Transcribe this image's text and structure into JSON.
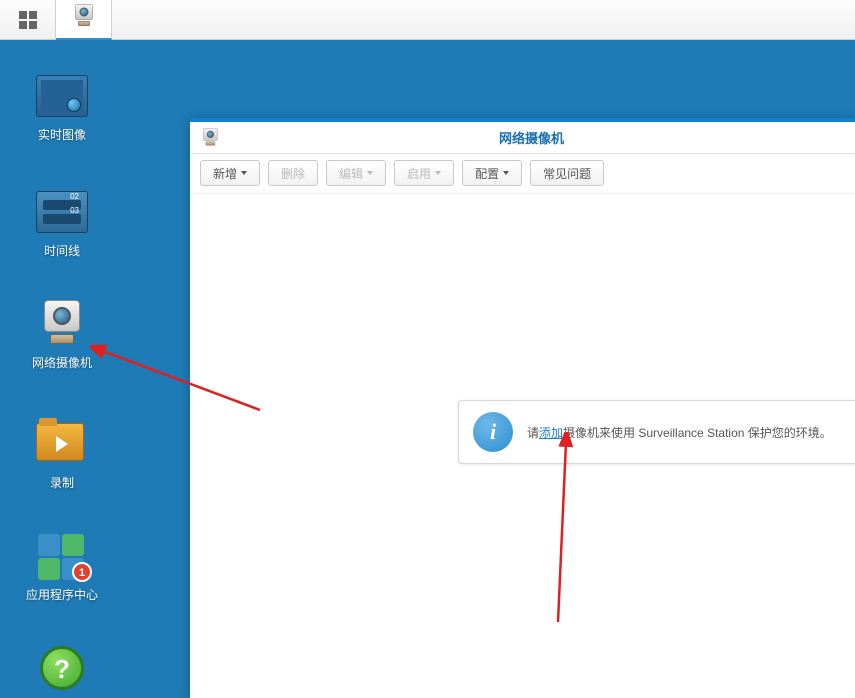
{
  "taskbar": {
    "menu_icon": "apps-grid-icon",
    "active_icon": "camera-icon"
  },
  "desktop": {
    "liveview": {
      "label": "实时图像"
    },
    "timeline": {
      "label": "时间线",
      "tag1": "02",
      "tag2": "03"
    },
    "camera": {
      "label": "网络摄像机"
    },
    "record": {
      "label": "录制"
    },
    "apps": {
      "label": "应用程序中心",
      "badge": "1"
    },
    "help": {
      "glyph": "?"
    }
  },
  "window": {
    "title": "网络摄像机",
    "toolbar": {
      "add": "新增",
      "delete": "删除",
      "edit": "编辑",
      "enable": "启用",
      "config": "配置",
      "faq": "常见问题"
    },
    "info": {
      "prefix": "请",
      "link": "添加",
      "suffix": "摄像机来使用 Surveillance Station 保护您的环境。"
    }
  }
}
